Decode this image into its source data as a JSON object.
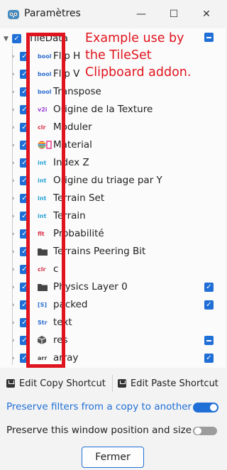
{
  "window": {
    "title": "Paramètres",
    "min_glyph": "—",
    "max_glyph": "☐",
    "close_glyph": "✕"
  },
  "tree": {
    "root": {
      "label": "TileData",
      "checked": true
    },
    "items": [
      {
        "label": "Flip H",
        "type": "bool",
        "type_color": "#2f6fd0",
        "checked": true
      },
      {
        "label": "Flip V",
        "type": "bool",
        "type_color": "#2f6fd0",
        "checked": true
      },
      {
        "label": "Transpose",
        "type": "bool",
        "type_color": "#2f6fd0",
        "checked": true
      },
      {
        "label": "Origine de la Texture",
        "type": "v2i",
        "type_color": "#9a3fd6",
        "checked": true
      },
      {
        "label": "Moduler",
        "type": "clr",
        "type_color": "#d8334a",
        "checked": true
      },
      {
        "label": "Material",
        "type": "material-icon",
        "type_color": "#e08a20",
        "checked": true
      },
      {
        "label": "Index Z",
        "type": "int",
        "type_color": "#27a3d6",
        "checked": true
      },
      {
        "label": "Origine du triage par Y",
        "type": "int",
        "type_color": "#27a3d6",
        "checked": true
      },
      {
        "label": "Terrain Set",
        "type": "int",
        "type_color": "#27a3d6",
        "checked": true
      },
      {
        "label": "Terrain",
        "type": "int",
        "type_color": "#27a3d6",
        "checked": true
      },
      {
        "label": "Probabilité",
        "type": "flt",
        "type_color": "#d8334a",
        "checked": true
      },
      {
        "label": "Terrains Peering Bit",
        "type": "folder-icon",
        "type_color": "#444444",
        "checked": true
      },
      {
        "label": "c",
        "type": "clr",
        "type_color": "#d8334a",
        "checked": true
      },
      {
        "label": "Physics Layer 0",
        "type": "folder-icon",
        "type_color": "#444444",
        "checked": true
      },
      {
        "label": "packed",
        "type": "[S]",
        "type_color": "#2f6fd0",
        "checked": true
      },
      {
        "label": "text",
        "type": "Str",
        "type_color": "#2f6fd0",
        "checked": true
      },
      {
        "label": "res",
        "type": "cube-icon",
        "type_color": "#444444",
        "checked": true
      },
      {
        "label": "array",
        "type": "arr",
        "type_color": "#444444",
        "checked": true
      }
    ],
    "right_checks": [
      {
        "row": 0,
        "state": "indeterminate"
      },
      {
        "row": 14,
        "state": "checked"
      },
      {
        "row": 15,
        "state": "checked"
      },
      {
        "row": 17,
        "state": "indeterminate"
      },
      {
        "row": 18,
        "state": "checked"
      }
    ]
  },
  "annotation": {
    "text_line1": "Example use by",
    "text_line2": "the TileSet",
    "text_line3": "Clipboard addon.",
    "color": "#e0141e"
  },
  "buttons": {
    "edit_copy": "Edit Copy Shortcut",
    "edit_paste": "Edit Paste Shortcut",
    "fermer": "Fermer"
  },
  "options": [
    {
      "label": "Preserve filters from a copy to another",
      "on": true,
      "color": "#1f6fd6"
    },
    {
      "label": "Preserve this window position and size",
      "on": false,
      "color": "#1e1e1e"
    }
  ]
}
